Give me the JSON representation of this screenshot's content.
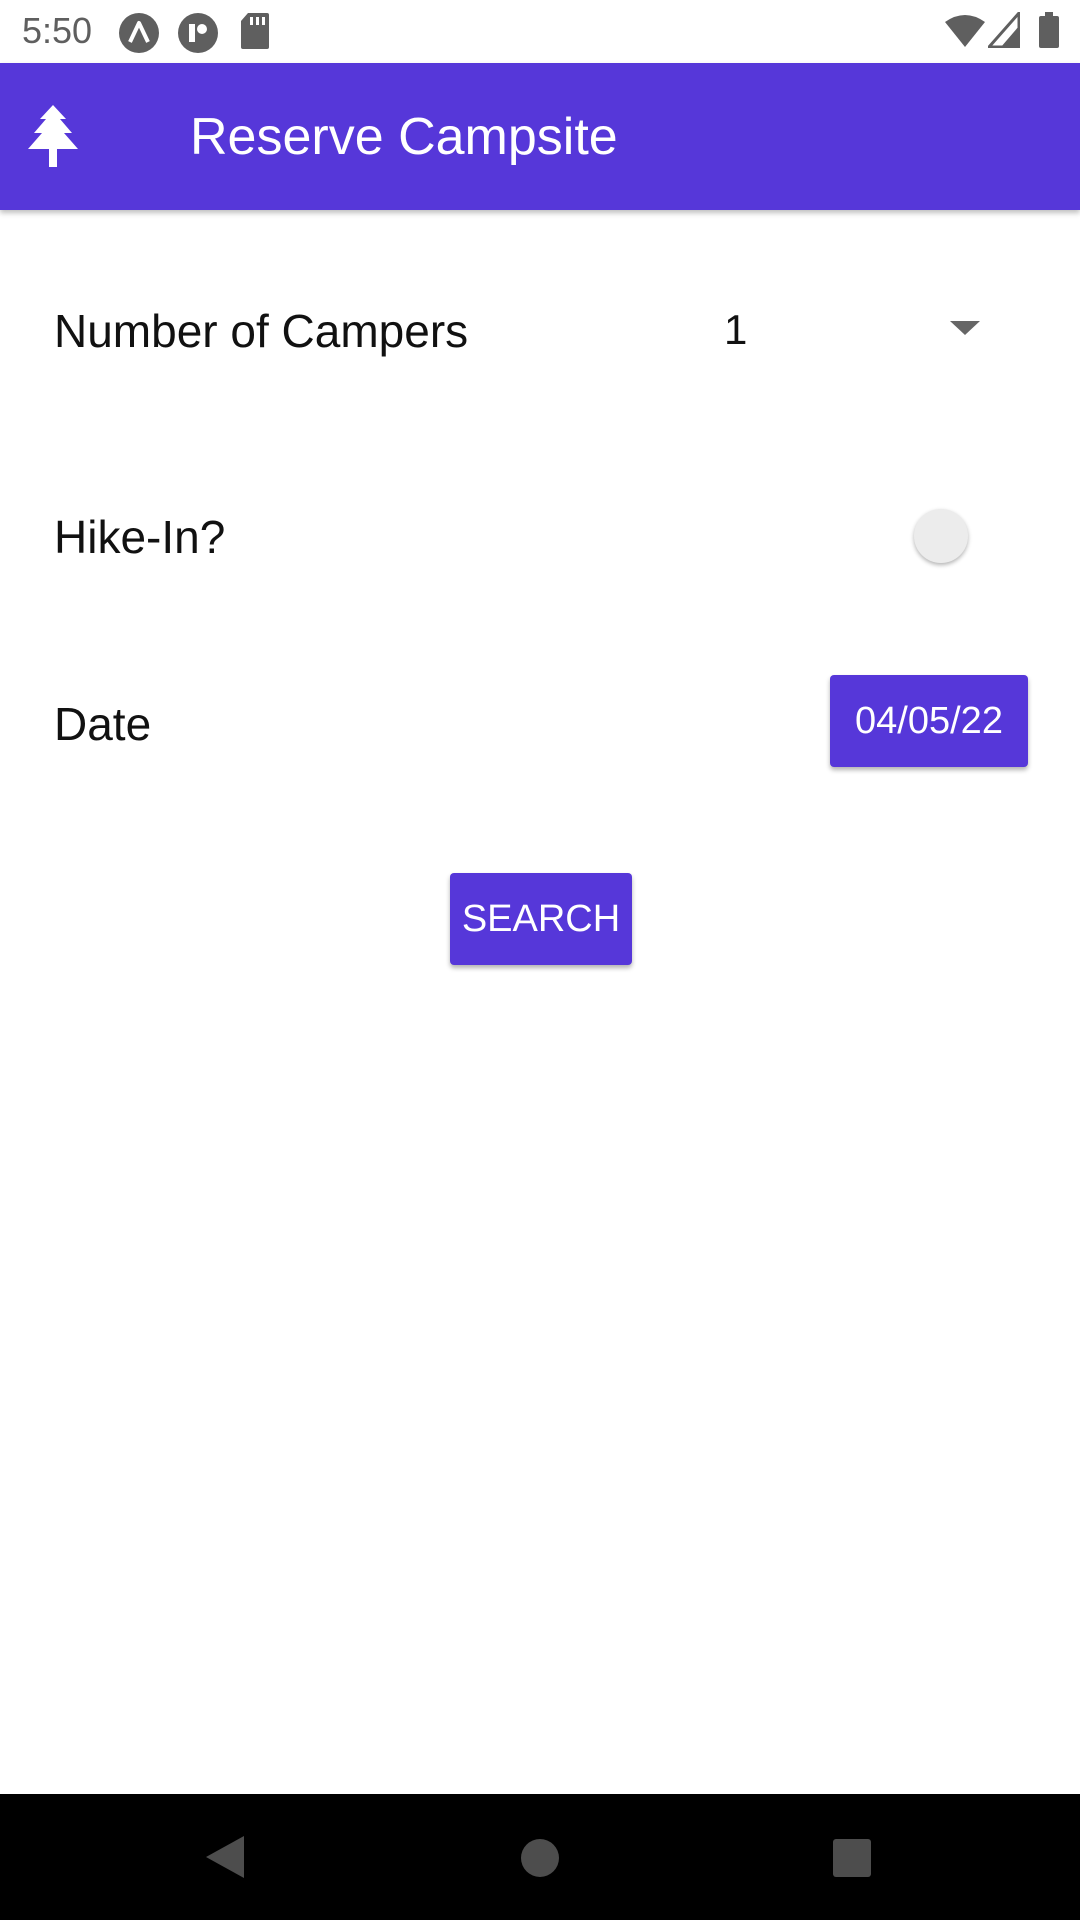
{
  "status_bar": {
    "time": "5:50",
    "left_icons": [
      "a-icon",
      "nfc-icon",
      "sd-card-icon"
    ],
    "right_icons": [
      "wifi-icon",
      "signal-icon",
      "battery-icon"
    ]
  },
  "app_bar": {
    "icon": "tree-icon",
    "title": "Reserve Campsite",
    "color": "#5637d9"
  },
  "form": {
    "campers_label": "Number of Campers",
    "campers_value": "1",
    "hike_in_label": "Hike-In?",
    "hike_in_enabled": false,
    "date_label": "Date",
    "date_value": "04/05/22",
    "search_label": "SEARCH"
  },
  "nav_bar": {
    "icons": [
      "back-icon",
      "home-icon",
      "recents-icon"
    ]
  }
}
